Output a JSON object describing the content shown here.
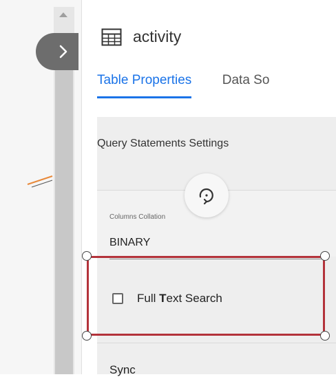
{
  "panel": {
    "title": "activity",
    "title_icon": "table-icon"
  },
  "tabs": [
    {
      "label": "Table Properties",
      "active": true
    },
    {
      "label": "Data So",
      "active": false
    }
  ],
  "section": {
    "header": "Query Statements Settings",
    "columns_collation": {
      "label": "Columns Collation",
      "value": "BINARY"
    },
    "full_text_search": {
      "label_prefix": "Full ",
      "label_bold": "T",
      "label_suffix": "ext Search",
      "checked": false
    },
    "sync_label": "Sync"
  },
  "icons": {
    "collapse": "chevron-right-icon",
    "rotate": "rotate-icon",
    "scroll_up": "scroll-up-arrow-icon"
  },
  "colors": {
    "accent": "#1a73e8",
    "selection": "#b3323a",
    "collapse_button": "#6d6d6d"
  }
}
